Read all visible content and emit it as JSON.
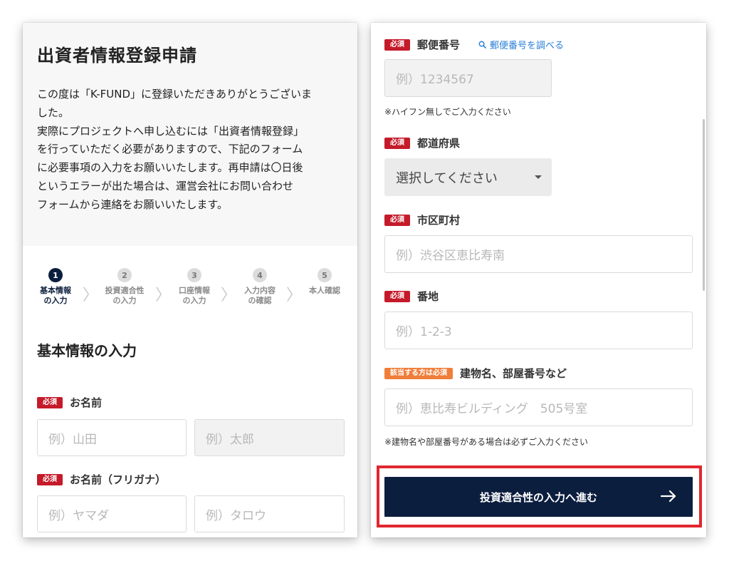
{
  "left": {
    "title": "出資者情報登録申請",
    "intro_lines": [
      "この度は「K-FUND」に登録いただきありがとうございま",
      "した。",
      "実際にプロジェクトへ申し込むには「出資者情報登録」",
      "を行っていただく必要がありますので、下記のフォーム",
      "に必要事項の入力をお願いいたします。再申請は〇日後",
      "というエラーが出た場合は、運営会社にお問い合わせ",
      "フォームから連絡をお願いいたします。"
    ],
    "steps": [
      {
        "num": "1",
        "line1": "基本情報",
        "line2": "の入力",
        "active": true
      },
      {
        "num": "2",
        "line1": "投資適合性",
        "line2": "の入力",
        "active": false
      },
      {
        "num": "3",
        "line1": "口座情報",
        "line2": "の入力",
        "active": false
      },
      {
        "num": "4",
        "line1": "入力内容",
        "line2": "の確認",
        "active": false
      },
      {
        "num": "5",
        "line1": "本人確認",
        "line2": "",
        "active": false
      }
    ],
    "section_title": "基本情報の入力",
    "name": {
      "badge": "必須",
      "label": "お名前",
      "last_placeholder": "例）山田",
      "first_placeholder": "例）太郎"
    },
    "name_kana": {
      "badge": "必須",
      "label": "お名前（フリガナ）",
      "last_placeholder": "例）ヤマダ",
      "first_placeholder": "例）タロウ"
    }
  },
  "right": {
    "postal": {
      "badge": "必須",
      "label": "郵便番号",
      "link": "郵便番号を調べる",
      "placeholder": "例）1234567",
      "note": "※ハイフン無しでご入力ください"
    },
    "prefecture": {
      "badge": "必須",
      "label": "都道府県",
      "selected": "選択してください"
    },
    "city": {
      "badge": "必須",
      "label": "市区町村",
      "placeholder": "例）渋谷区恵比寿南"
    },
    "address": {
      "badge": "必須",
      "label": "番地",
      "placeholder": "例）1-2-3"
    },
    "building": {
      "badge": "該当する方は必須",
      "label": "建物名、部屋番号など",
      "placeholder": "例）恵比寿ビルディング　505号室",
      "note": "※建物名や部屋番号がある場合は必ずご入力ください"
    },
    "submit": {
      "label": "投資適合性の入力へ進む",
      "icon": "arrow-right-icon"
    }
  },
  "colors": {
    "navy": "#0c1e3e",
    "required_badge": "#c51a2a",
    "conditional_badge": "#ef7e3a",
    "link": "#2a7ed9",
    "highlight": "#e1262f"
  }
}
